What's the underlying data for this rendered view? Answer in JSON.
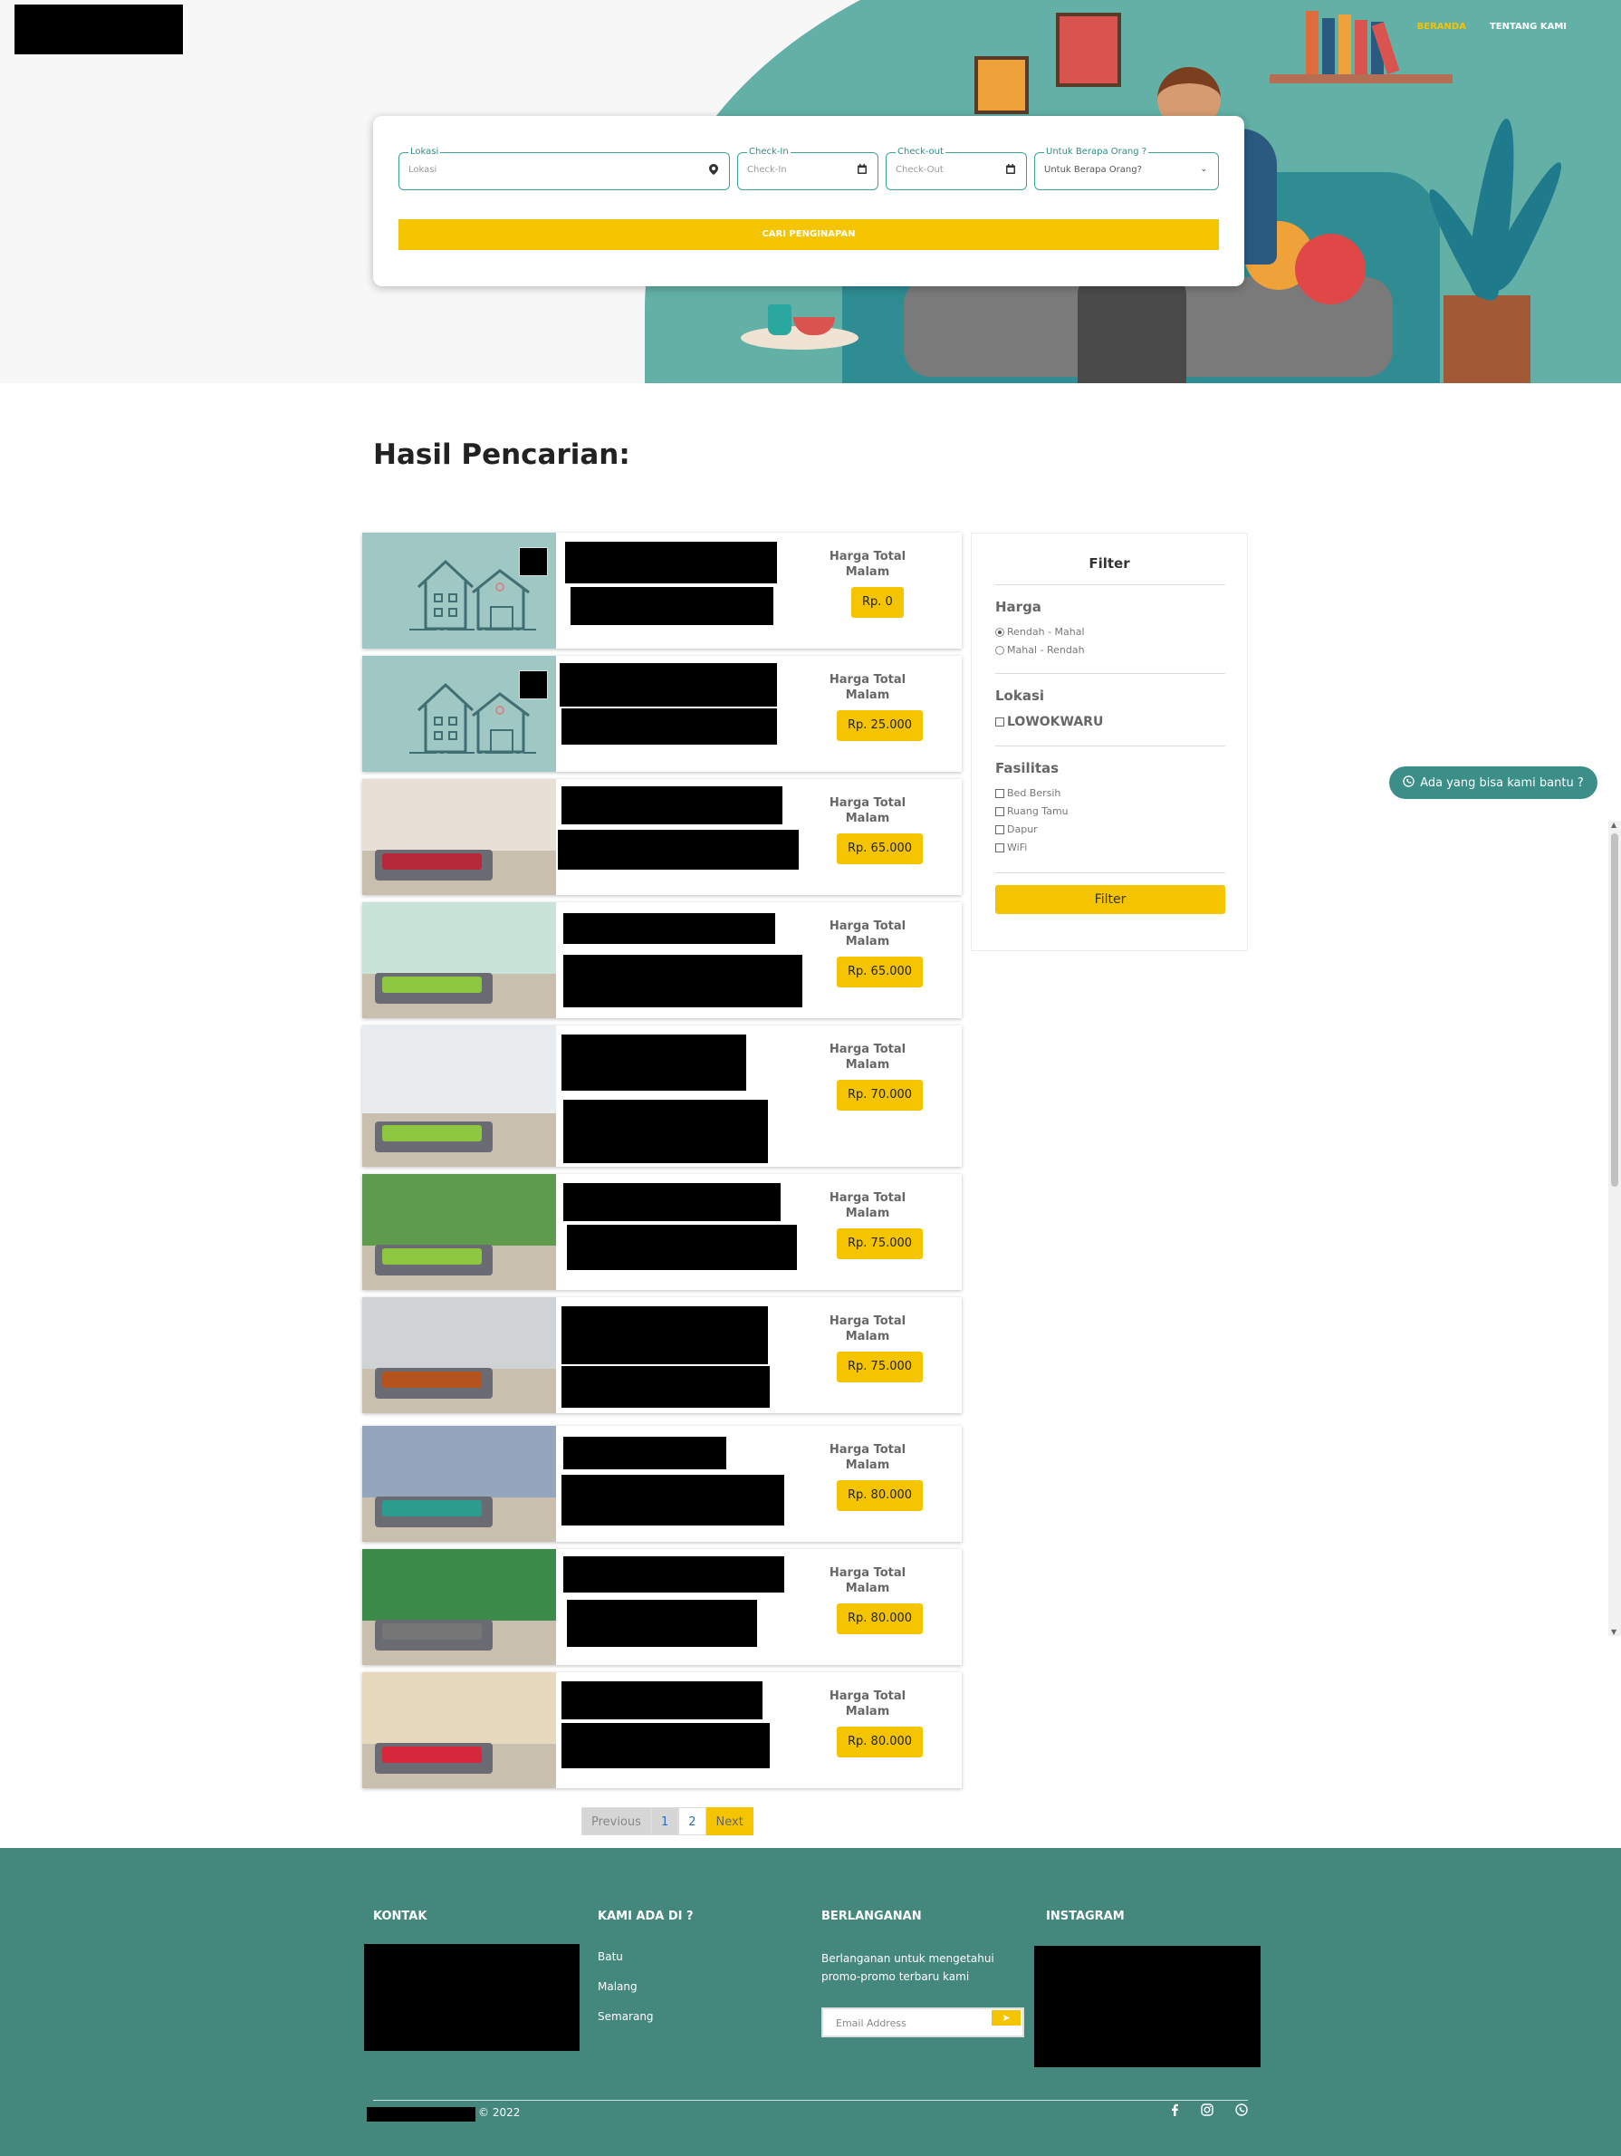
{
  "nav": {
    "home": "BERANDA",
    "about": "TENTANG KAMI"
  },
  "search": {
    "location_label": "Lokasi",
    "location_placeholder": "Lokasi",
    "checkin_label": "Check-In",
    "checkin_placeholder": "Check-In",
    "checkout_label": "Check-out",
    "checkout_placeholder": "Check-Out",
    "guests_label": "Untuk Berapa Orang ?",
    "guests_value": "Untuk Berapa Orang?",
    "button": "CARI PENGINAPAN"
  },
  "results": {
    "title": "Hasil Pencarian:",
    "price_label_line1": "Harga Total",
    "price_label_line2": "Malam",
    "items": [
      {
        "price": "Rp. 0",
        "image": "house-placeholder"
      },
      {
        "price": "Rp. 25.000",
        "image": "house-placeholder"
      },
      {
        "price": "Rp. 65.000",
        "image": "room-photo"
      },
      {
        "price": "Rp. 65.000",
        "image": "room-photo"
      },
      {
        "price": "Rp. 70.000",
        "image": "room-photo"
      },
      {
        "price": "Rp. 75.000",
        "image": "room-photo"
      },
      {
        "price": "Rp. 75.000",
        "image": "room-photo"
      },
      {
        "price": "Rp. 80.000",
        "image": "room-photo"
      },
      {
        "price": "Rp. 80.000",
        "image": "room-photo"
      },
      {
        "price": "Rp. 80.000",
        "image": "room-photo"
      }
    ]
  },
  "filter": {
    "title": "Filter",
    "price_heading": "Harga",
    "price_options": [
      "Rendah - Mahal",
      "Mahal - Rendah"
    ],
    "price_selected": 0,
    "location_heading": "Lokasi",
    "location_option": "LOWOKWARU",
    "facilities_heading": "Fasilitas",
    "facilities": [
      "Bed Bersih",
      "Ruang Tamu",
      "Dapur",
      "WiFi"
    ],
    "button": "Filter"
  },
  "chat": {
    "label": "Ada yang bisa kami bantu ?",
    "icon": "whatsapp-icon"
  },
  "pagination": {
    "previous": "Previous",
    "page1": "1",
    "page2": "2",
    "next": "Next"
  },
  "footer": {
    "contact_heading": "KONTAK",
    "locations_heading": "KAMI ADA DI ?",
    "locations": [
      "Batu",
      "Malang",
      "Semarang"
    ],
    "subscribe_heading": "BERLANGANAN",
    "subscribe_text": "Berlanganan untuk mengetahui promo-promo terbaru kami",
    "email_placeholder": "Email Address",
    "instagram_heading": "INSTAGRAM",
    "copyright": "© 2022",
    "social_icons": [
      "facebook-icon",
      "instagram-icon",
      "whatsapp-icon"
    ]
  },
  "colors": {
    "accent": "#f5c400",
    "teal": "#44877d",
    "hero_teal": "#62b0a6"
  }
}
